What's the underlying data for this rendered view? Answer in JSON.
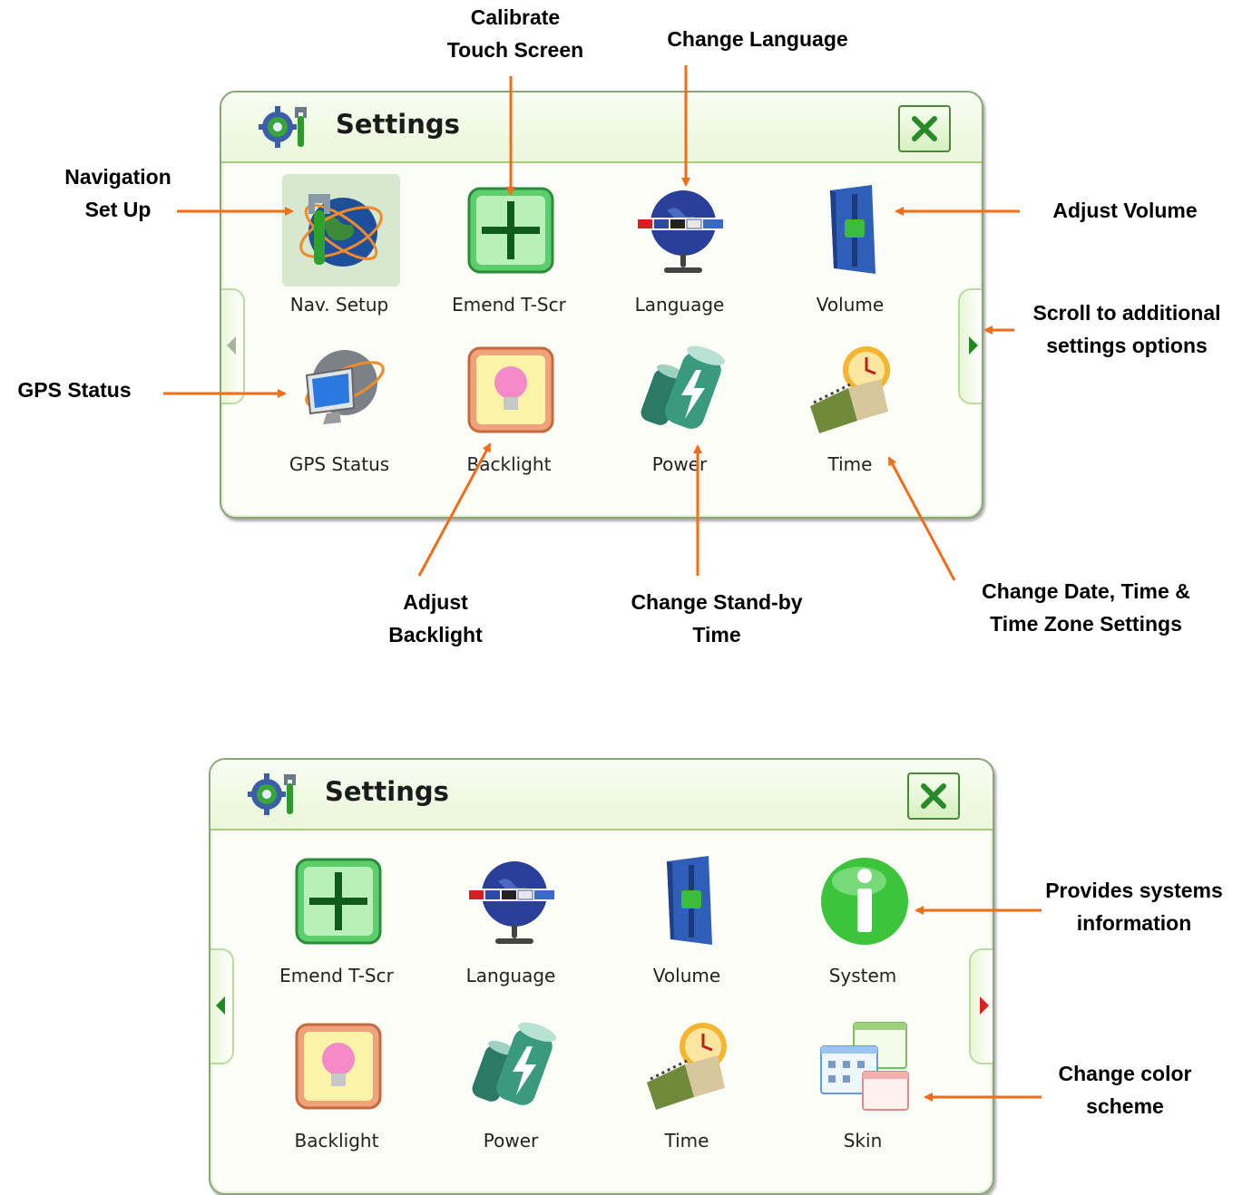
{
  "screen1": {
    "title": "Settings",
    "items": [
      {
        "label": "Nav. Setup",
        "icon": "nav-setup-globe-wrench-icon"
      },
      {
        "label": "Emend T-Scr",
        "icon": "crosshair-calibrate-icon"
      },
      {
        "label": "Language",
        "icon": "globe-flags-icon"
      },
      {
        "label": "Volume",
        "icon": "volume-slider-icon"
      },
      {
        "label": "GPS Status",
        "icon": "monitor-globe-icon"
      },
      {
        "label": "Backlight",
        "icon": "lightbulb-icon"
      },
      {
        "label": "Power",
        "icon": "battery-bolt-icon"
      },
      {
        "label": "Time",
        "icon": "calendar-clock-icon"
      }
    ]
  },
  "screen2": {
    "title": "Settings",
    "items": [
      {
        "label": "Emend T-Scr",
        "icon": "crosshair-calibrate-icon"
      },
      {
        "label": "Language",
        "icon": "globe-flags-icon"
      },
      {
        "label": "Volume",
        "icon": "volume-slider-icon"
      },
      {
        "label": "System",
        "icon": "info-icon"
      },
      {
        "label": "Backlight",
        "icon": "lightbulb-icon"
      },
      {
        "label": "Power",
        "icon": "battery-bolt-icon"
      },
      {
        "label": "Time",
        "icon": "calendar-clock-icon"
      },
      {
        "label": "Skin",
        "icon": "skin-windows-icon"
      }
    ]
  },
  "annotations": {
    "calibrate": [
      "Calibrate",
      "Touch Screen"
    ],
    "change_language": "Change Language",
    "nav_setup": [
      "Navigation",
      "Set Up"
    ],
    "adjust_volume": "Adjust Volume",
    "scroll": [
      "Scroll to additional",
      "settings options"
    ],
    "gps_status": "GPS Status",
    "adjust_backlight": [
      "Adjust",
      "Backlight"
    ],
    "standby": [
      "Change Stand-by",
      "Time"
    ],
    "date_time": [
      "Change Date, Time &",
      "Time Zone Settings"
    ],
    "system_info": [
      "Provides systems",
      "information"
    ],
    "color_scheme": [
      "Change color",
      "scheme"
    ]
  },
  "colors": {
    "arrow": "#f26c1a",
    "panel_border": "#8aa67a",
    "titlebar": "#eaf7d9",
    "accent_green": "#2e8b2e",
    "scroll_arrow_green": "#1f8a1f",
    "scroll_arrow_red": "#dd2020"
  }
}
